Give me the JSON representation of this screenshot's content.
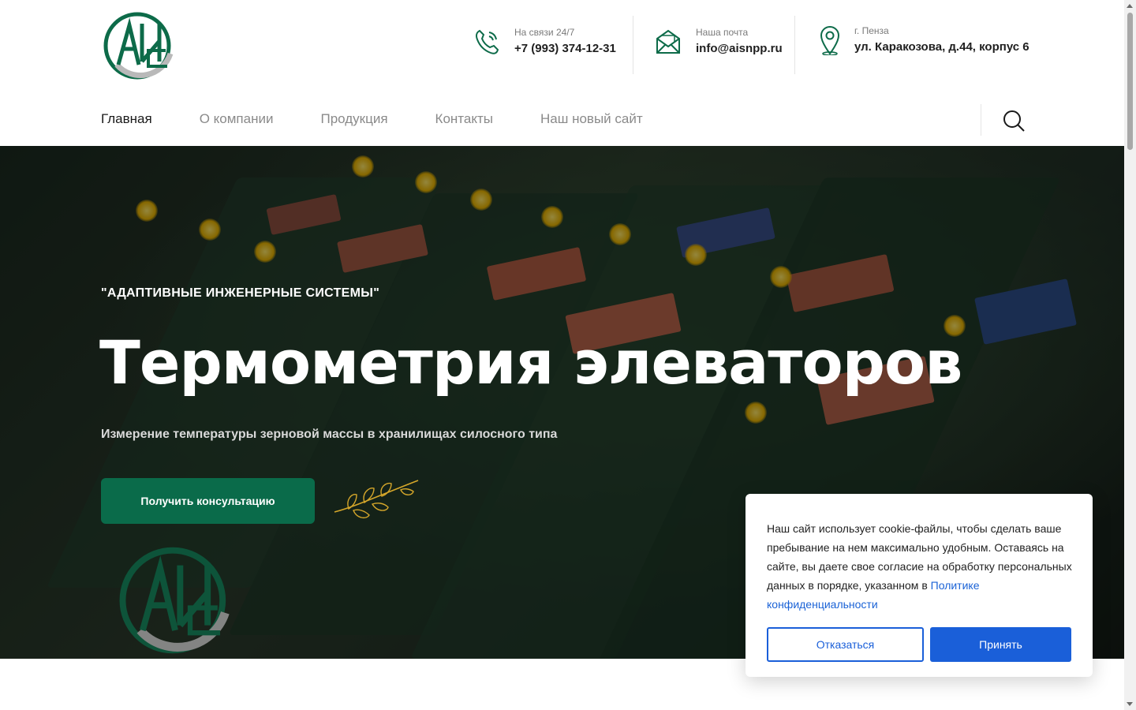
{
  "header": {
    "logo_alt": "АИС",
    "phone": {
      "label": "На связи 24/7",
      "value": "+7 (993) 374-12-31",
      "icon": "phone-icon"
    },
    "email": {
      "label": "Наша почта",
      "value": "info@aisnpp.ru",
      "icon": "mail-icon"
    },
    "address": {
      "label": "г. Пенза",
      "value": "ул. Каракозова, д.44, корпус 6",
      "icon": "location-pin-icon"
    }
  },
  "nav": {
    "items": [
      {
        "label": "Главная"
      },
      {
        "label": "О компании"
      },
      {
        "label": "Продукция"
      },
      {
        "label": "Контакты"
      },
      {
        "label": "Наш новый сайт"
      }
    ],
    "search_icon": "search-icon"
  },
  "hero": {
    "subtitle": "\"АДАПТИВНЫЕ ИНЖЕНЕРНЫЕ СИСТЕМЫ\"",
    "title": "Термометрия элеваторов",
    "description": "Измерение температуры зерновой массы в хранилищах силосного типа",
    "cta_label": "Получить консультацию"
  },
  "cookie": {
    "text": "Наш сайт использует cookie-файлы, чтобы сделать ваше пребывание на нем максимально удобным. Оставаясь на сайте, вы даете свое согласие на обработку персональных данных в порядке, указанном в ",
    "link": "Политике конфиденциальности",
    "decline_label": "Отказаться",
    "accept_label": "Принять"
  },
  "colors": {
    "brand_green": "#0a6b4a",
    "accent_blue": "#1a5fd9",
    "logo_gray": "#b9b9b9"
  }
}
